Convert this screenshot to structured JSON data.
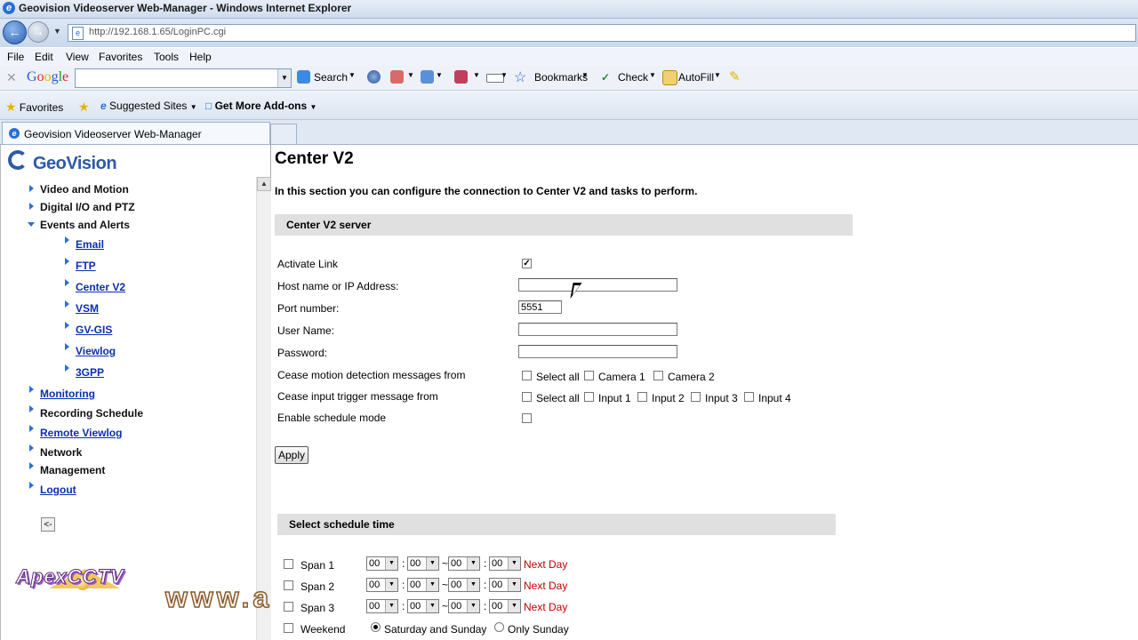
{
  "browser": {
    "window_title": "Geovision Videoserver Web-Manager - Windows Internet Explorer",
    "url": "http://192.168.1.65/LoginPC.cgi",
    "menu": [
      "File",
      "Edit",
      "View",
      "Favorites",
      "Tools",
      "Help"
    ],
    "google_toolbar": {
      "logo": "Google",
      "search_label": "Search",
      "bookmarks_label": "Bookmarks",
      "check_label": "Check",
      "autofill_label": "AutoFill"
    },
    "favorites_bar": {
      "favorites_label": "Favorites",
      "suggested_sites": "Suggested Sites",
      "get_more_addons": "Get More Add-ons"
    },
    "tab_title": "Geovision Videoserver Web-Manager"
  },
  "sidebar": {
    "logo_text": "GeoVision",
    "items": [
      {
        "label": "Video and Motion"
      },
      {
        "label": "Digital I/O and PTZ"
      },
      {
        "label": "Events and Alerts"
      },
      {
        "label": "Email"
      },
      {
        "label": "FTP"
      },
      {
        "label": "Center V2"
      },
      {
        "label": "VSM"
      },
      {
        "label": "GV-GIS"
      },
      {
        "label": "Viewlog"
      },
      {
        "label": "3GPP"
      },
      {
        "label": "Monitoring"
      },
      {
        "label": "Recording Schedule"
      },
      {
        "label": "Remote Viewlog"
      },
      {
        "label": "Network"
      },
      {
        "label": "Management"
      },
      {
        "label": "Logout"
      }
    ],
    "collapse_label": "<-"
  },
  "main": {
    "title": "Center V2",
    "intro": "In this section you can configure the connection to Center V2 and tasks to perform.",
    "server_section": "Center V2 server",
    "fields": {
      "activate_link": {
        "label": "Activate Link",
        "checked": true
      },
      "host": {
        "label": "Host name or IP Address:",
        "value": ""
      },
      "port": {
        "label": "Port number:",
        "value": "5551"
      },
      "user": {
        "label": "User Name:",
        "value": ""
      },
      "password": {
        "label": "Password:",
        "value": ""
      },
      "cease_motion": {
        "label": "Cease motion detection messages from",
        "options": [
          "Select all",
          "Camera 1",
          "Camera 2"
        ]
      },
      "cease_input": {
        "label": "Cease input trigger message from",
        "options": [
          "Select all",
          "Input 1",
          "Input 2",
          "Input 3",
          "Input 4"
        ]
      },
      "schedule_mode": {
        "label": "Enable schedule mode",
        "checked": false
      }
    },
    "apply_label": "Apply",
    "schedule_section": "Select schedule time",
    "spans": [
      {
        "label": "Span 1",
        "h1": "00",
        "m1": "00",
        "h2": "00",
        "m2": "00",
        "next_day": "Next Day"
      },
      {
        "label": "Span 2",
        "h1": "00",
        "m1": "00",
        "h2": "00",
        "m2": "00",
        "next_day": "Next Day"
      },
      {
        "label": "Span 3",
        "h1": "00",
        "m1": "00",
        "h2": "00",
        "m2": "00",
        "next_day": "Next Day"
      }
    ],
    "weekend": {
      "label": "Weekend",
      "options": [
        "Saturday and Sunday",
        "Only Sunday"
      ],
      "selected": "Saturday and Sunday"
    }
  },
  "watermark": {
    "apex_text": "ApexCCTV",
    "url_text": "www.apexcctv.com"
  }
}
